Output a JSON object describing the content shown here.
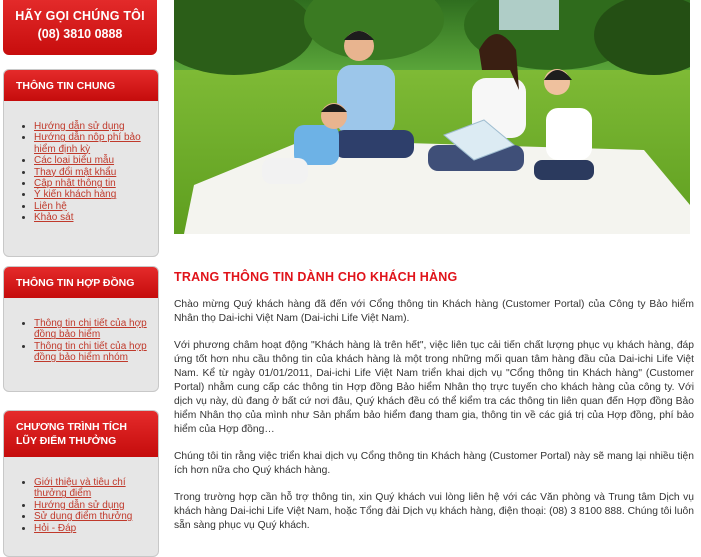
{
  "call_box": {
    "line1": "HÃY GỌI CHÚNG TÔI",
    "phone": "(08) 3810 0888"
  },
  "panels": {
    "general": {
      "title": "THÔNG TIN CHUNG",
      "items": [
        "Hướng dẫn sử dụng",
        "Hướng dẫn nộp phí bảo hiểm định kỳ",
        "Các loại biểu mẫu",
        "Thay đổi mật khẩu",
        "Cập nhật thông tin",
        "Ý kiến khách hàng",
        "Liên hệ",
        "Khảo sát"
      ]
    },
    "contracts": {
      "title": "THÔNG TIN HỢP ĐỒNG",
      "items": [
        "Thông tin chi tiết của hợp đồng bảo hiểm",
        "Thông tin chi tiết của hợp đồng bảo hiểm nhóm"
      ]
    },
    "loyalty": {
      "title": "CHƯƠNG TRÌNH TÍCH LŨY ĐIỂM THƯỞNG",
      "items": [
        "Giới thiệu và tiêu chí thưởng điểm",
        "Hướng dẫn sử dụng",
        "Sử dụng điểm thưởng",
        "Hỏi - Đáp"
      ]
    }
  },
  "main": {
    "heading": "TRANG THÔNG TIN DÀNH CHO KHÁCH HÀNG",
    "paragraphs": [
      "Chào mừng Quý khách hàng đã đến với Cổng thông tin Khách hàng (Customer Portal) của Công ty Bảo hiểm Nhân thọ Dai-ichi Việt Nam (Dai-ichi Life Việt Nam).",
      "Với phương châm hoạt động \"Khách hàng là trên hết\", việc liên tục cải tiến chất lượng phục vụ khách hàng, đáp ứng tốt hơn nhu cầu thông tin của khách hàng là một trong những mối quan tâm hàng đầu của Dai-ichi Life Việt Nam. Kể từ ngày 01/01/2011, Dai-ichi Life Việt Nam triển khai dịch vụ \"Cổng thông tin Khách hàng\" (Customer Portal) nhằm cung cấp các thông tin Hợp đồng Bảo hiểm Nhân thọ trực tuyến cho khách hàng của công ty. Với dịch vụ này, dù đang ở bất cứ nơi đâu, Quý khách đều có thể kiểm tra các thông tin liên quan đến Hợp đồng Bảo hiểm Nhân thọ của mình như Sản phẩm bảo hiểm đang tham gia, thông tin về các giá trị của Hợp đồng, phí bảo hiểm của Hợp đồng…",
      "Chúng tôi tin rằng việc triển khai dịch vụ Cổng thông tin Khách hàng (Customer Portal) này sẽ mang lại nhiều tiện ích hơn nữa cho Quý khách hàng.",
      "Trong trường hợp cần hỗ trợ thông tin, xin Quý khách vui lòng liên hệ với các Văn phòng và Trung tâm Dịch vụ khách hàng Dai-ichi Life Việt Nam, hoặc Tổng đài Dịch vụ khách hàng, điện thoại: (08) 3 8100 888. Chúng tôi luôn sẵn sàng phục vụ Quý khách."
    ]
  },
  "colors": {
    "brand_red": "#d81b1b",
    "link": "#c0392b",
    "panel_bg": "#e6e6e6"
  }
}
